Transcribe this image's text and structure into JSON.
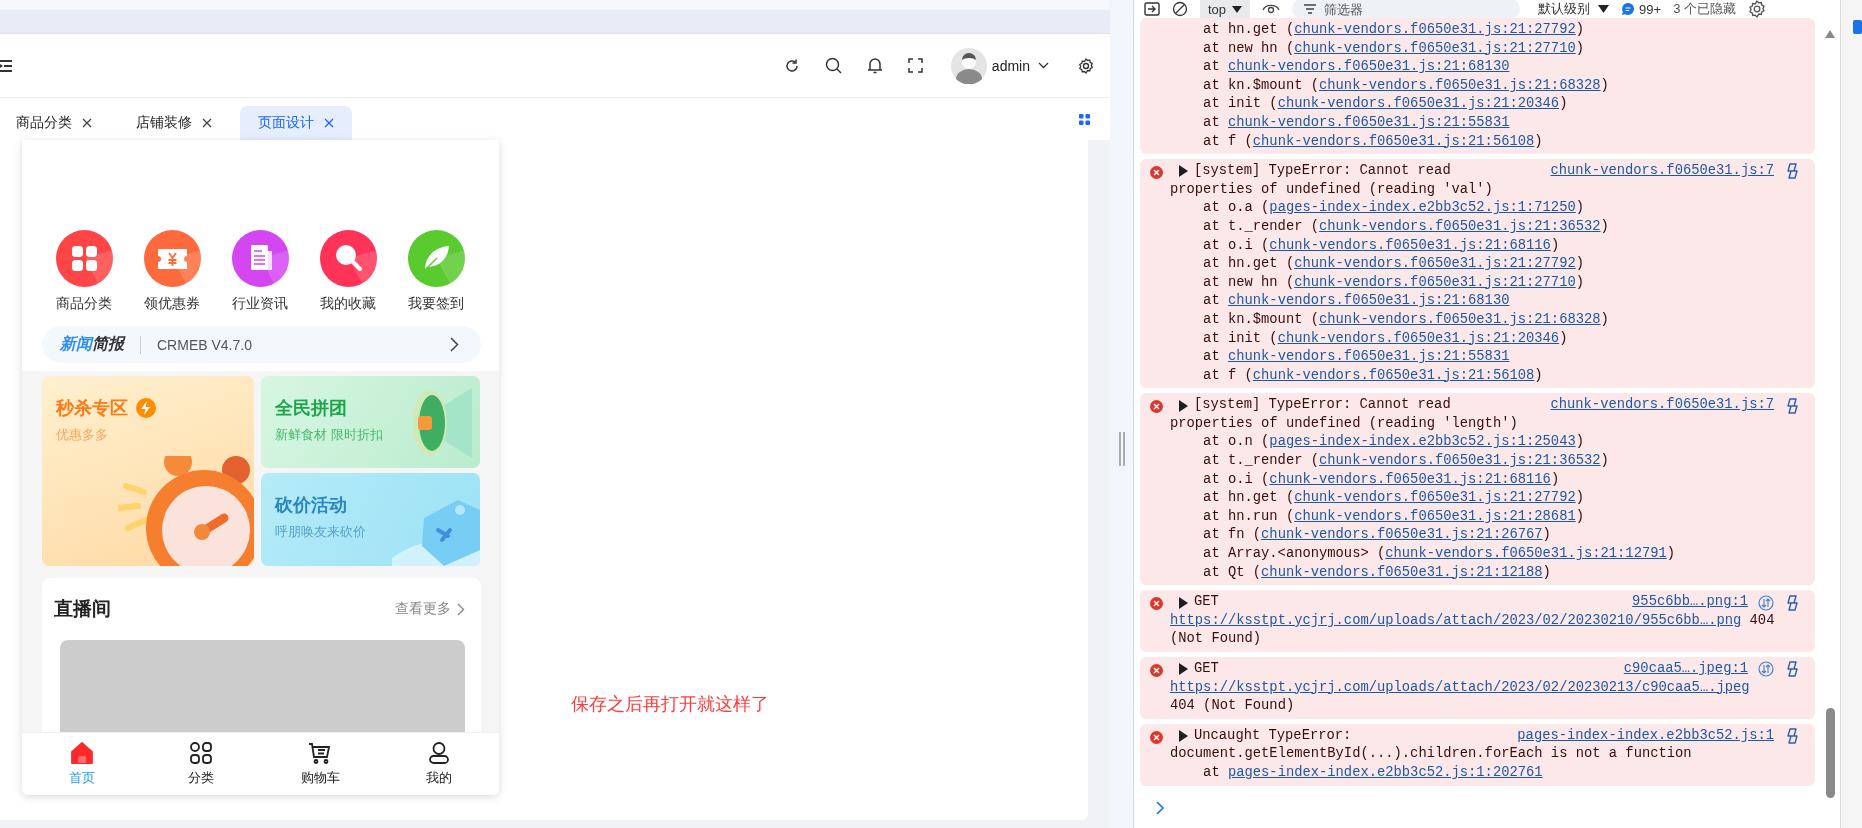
{
  "header": {
    "user": "admin"
  },
  "tabs": [
    {
      "label": "商品分类",
      "selected": false
    },
    {
      "label": "店铺装修",
      "selected": false
    },
    {
      "label": "页面设计",
      "selected": true
    }
  ],
  "phone": {
    "shortcuts": [
      {
        "label": "商品分类",
        "kind": "grid",
        "color": "#ff4545"
      },
      {
        "label": "领优惠券",
        "kind": "coupon",
        "color": "#ff6a3d"
      },
      {
        "label": "行业资讯",
        "kind": "document",
        "color": "#d446f2"
      },
      {
        "label": "我的收藏",
        "kind": "search",
        "color": "#ff3358"
      },
      {
        "label": "我要签到",
        "kind": "leaf",
        "color": "#5acb2e"
      }
    ],
    "news": {
      "title_highlight": "新闻",
      "title_rest": "简报",
      "text": "CRMEB V4.7.0"
    },
    "promos": [
      {
        "kind": "flash",
        "title": "秒杀专区",
        "subtitle": "优惠多多"
      },
      {
        "kind": "group",
        "title": "全民拼团",
        "subtitle": "新鲜食材 限时折扣"
      },
      {
        "kind": "bargain",
        "title": "砍价活动",
        "subtitle": "呼朋唤友来砍价"
      }
    ],
    "live": {
      "title": "直播间",
      "more": "查看更多"
    },
    "tabbar": [
      {
        "label": "首页",
        "kind": "home",
        "selected": true
      },
      {
        "label": "分类",
        "kind": "category",
        "selected": false
      },
      {
        "label": "购物车",
        "kind": "cart",
        "selected": false
      },
      {
        "label": "我的",
        "kind": "user",
        "selected": false
      }
    ]
  },
  "annotation": "保存之后再打开就这样了",
  "console": {
    "toolbar": {
      "context": "top",
      "filter_placeholder": "筛选器",
      "level": "默认级别",
      "issues": "99+",
      "hidden": "3 个已隐藏"
    },
    "messages": [
      {
        "kind": "continuation",
        "stack": [
          {
            "prefix": "at hn.get (",
            "link": "chunk-vendors.f0650e31.js:21:27792",
            "suffix": ")"
          },
          {
            "prefix": "at new hn (",
            "link": "chunk-vendors.f0650e31.js:21:27710",
            "suffix": ")"
          },
          {
            "prefix": "at ",
            "link": "chunk-vendors.f0650e31.js:21:68130"
          },
          {
            "prefix": "at kn.$mount (",
            "link": "chunk-vendors.f0650e31.js:21:68328",
            "suffix": ")"
          },
          {
            "prefix": "at init (",
            "link": "chunk-vendors.f0650e31.js:21:20346",
            "suffix": ")"
          },
          {
            "prefix": "at ",
            "link": "chunk-vendors.f0650e31.js:21:55831"
          },
          {
            "prefix": "at f (",
            "link": "chunk-vendors.f0650e31.js:21:56108",
            "suffix": ")"
          }
        ]
      },
      {
        "kind": "error",
        "head": "[system] TypeError: Cannot read",
        "source": "chunk-vendors.f0650e31.js:7",
        "lines": [
          {
            "prefix": "properties of undefined (reading 'val')"
          }
        ],
        "stack": [
          {
            "prefix": "at o.a (",
            "link": "pages-index-index.e2bb3c52.js:1:71250",
            "suffix": ")"
          },
          {
            "prefix": "at t._render (",
            "link": "chunk-vendors.f0650e31.js:21:36532",
            "suffix": ")"
          },
          {
            "prefix": "at o.i (",
            "link": "chunk-vendors.f0650e31.js:21:68116",
            "suffix": ")"
          },
          {
            "prefix": "at hn.get (",
            "link": "chunk-vendors.f0650e31.js:21:27792",
            "suffix": ")"
          },
          {
            "prefix": "at new hn (",
            "link": "chunk-vendors.f0650e31.js:21:27710",
            "suffix": ")"
          },
          {
            "prefix": "at ",
            "link": "chunk-vendors.f0650e31.js:21:68130"
          },
          {
            "prefix": "at kn.$mount (",
            "link": "chunk-vendors.f0650e31.js:21:68328",
            "suffix": ")"
          },
          {
            "prefix": "at init (",
            "link": "chunk-vendors.f0650e31.js:21:20346",
            "suffix": ")"
          },
          {
            "prefix": "at ",
            "link": "chunk-vendors.f0650e31.js:21:55831"
          },
          {
            "prefix": "at f (",
            "link": "chunk-vendors.f0650e31.js:21:56108",
            "suffix": ")"
          }
        ]
      },
      {
        "kind": "error",
        "head": "[system] TypeError: Cannot read",
        "source": "chunk-vendors.f0650e31.js:7",
        "lines": [
          {
            "prefix": "properties of undefined (reading 'length')"
          }
        ],
        "stack": [
          {
            "prefix": "at o.n (",
            "link": "pages-index-index.e2bb3c52.js:1:25043",
            "suffix": ")"
          },
          {
            "prefix": "at t._render (",
            "link": "chunk-vendors.f0650e31.js:21:36532",
            "suffix": ")"
          },
          {
            "prefix": "at o.i (",
            "link": "chunk-vendors.f0650e31.js:21:68116",
            "suffix": ")"
          },
          {
            "prefix": "at hn.get (",
            "link": "chunk-vendors.f0650e31.js:21:27792",
            "suffix": ")"
          },
          {
            "prefix": "at hn.run (",
            "link": "chunk-vendors.f0650e31.js:21:28681",
            "suffix": ")"
          },
          {
            "prefix": "at fn (",
            "link": "chunk-vendors.f0650e31.js:21:26767",
            "suffix": ")"
          },
          {
            "prefix": "at Array.<anonymous> (",
            "link": "chunk-vendors.f0650e31.js:21:12791",
            "suffix": ")"
          },
          {
            "prefix": "at Qt (",
            "link": "chunk-vendors.f0650e31.js:21:12188",
            "suffix": ")"
          }
        ]
      },
      {
        "kind": "network",
        "head": "GET",
        "source": "955c6bb….png:1",
        "lines": [
          {
            "link": "https://ksstpt.ycjrj.com/uploads/attach/2023/02/20230210/955c6bb….png",
            "suffix": " 404"
          },
          {
            "prefix": "(Not Found)"
          }
        ]
      },
      {
        "kind": "network",
        "head": "GET",
        "source": "c90caa5….jpeg:1",
        "lines": [
          {
            "link": "https://ksstpt.ycjrj.com/uploads/attach/2023/02/20230213/c90caa5….jpeg"
          },
          {
            "prefix": "404 (Not Found)"
          }
        ]
      },
      {
        "kind": "error",
        "head": "Uncaught TypeError:",
        "source": "pages-index-index.e2bb3c52.js:1",
        "lines": [
          {
            "prefix": "document.getElementById(...).children.forEach is not a function"
          }
        ],
        "stack": [
          {
            "prefix": "at ",
            "link": "pages-index-index.e2bb3c52.js:1:202761"
          }
        ]
      }
    ]
  }
}
